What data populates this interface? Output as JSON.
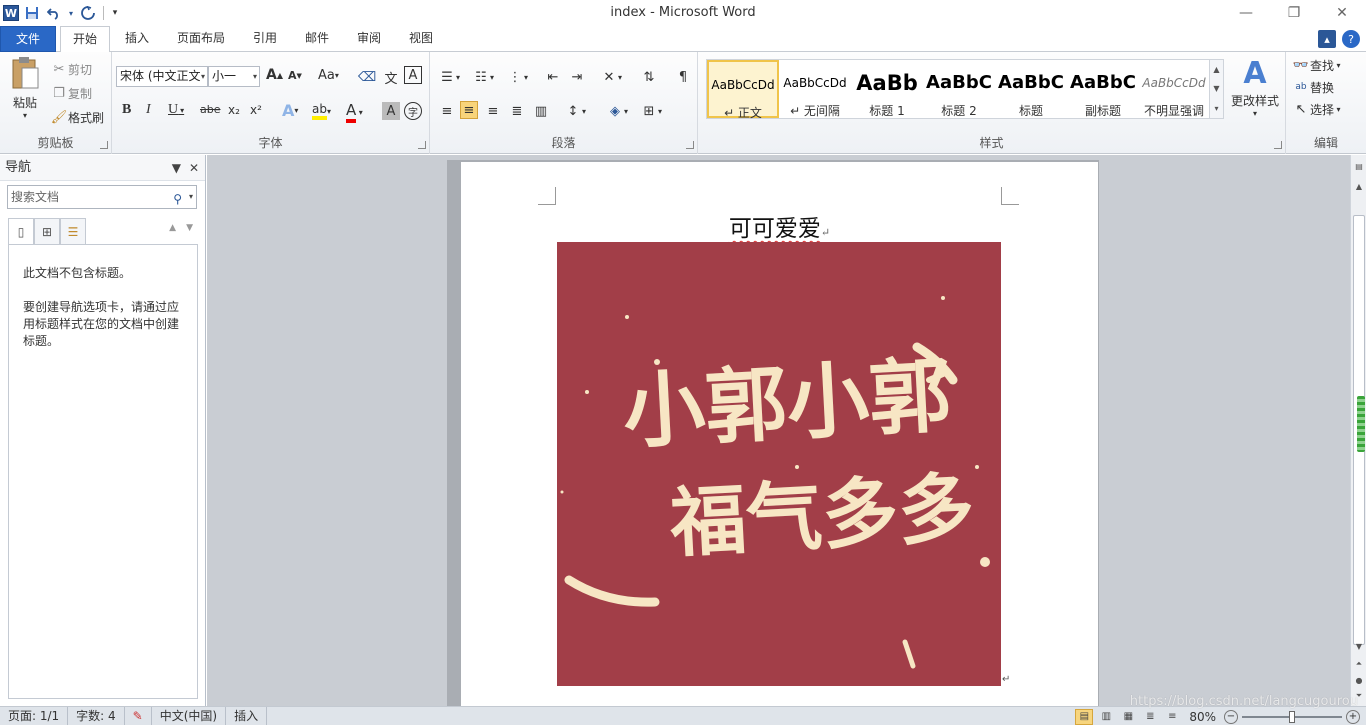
{
  "window": {
    "title": "index  -  Microsoft Word",
    "app_icon_letter": "W",
    "minimize": "—",
    "restore": "❐",
    "close": "✕"
  },
  "quick_access": {
    "save_icon": "save-icon",
    "undo_icon": "undo-icon",
    "redo_icon": "redo-icon",
    "customize_icon": "chevron-down-icon"
  },
  "tabs": [
    {
      "label": "文件"
    },
    {
      "label": "开始"
    },
    {
      "label": "插入"
    },
    {
      "label": "页面布局"
    },
    {
      "label": "引用"
    },
    {
      "label": "邮件"
    },
    {
      "label": "审阅"
    },
    {
      "label": "视图"
    }
  ],
  "ribbon": {
    "clipboard": {
      "label": "剪贴板",
      "paste": "粘贴",
      "cut": "剪切",
      "copy": "复制",
      "format_painter": "格式刷"
    },
    "font": {
      "label": "字体",
      "font_name": "宋体 (中文正文",
      "font_size": "小一",
      "grow": "A",
      "shrink": "A",
      "change_case": "Aa",
      "bold": "B",
      "italic": "I",
      "underline": "U",
      "strike": "abe",
      "subscript": "x₂",
      "superscript": "x²",
      "text_effect": "A",
      "highlight": "ab",
      "font_color": "A",
      "char_shade": "A",
      "enclose": "字"
    },
    "paragraph": {
      "label": "段落"
    },
    "styles": {
      "label": "样式",
      "items": [
        {
          "sample": "AaBbCcDd",
          "name": "↵ 正文"
        },
        {
          "sample": "AaBbCcDd",
          "name": "↵ 无间隔"
        },
        {
          "sample": "AaBb",
          "name": "标题 1"
        },
        {
          "sample": "AaBbC",
          "name": "标题 2"
        },
        {
          "sample": "AaBbC",
          "name": "标题"
        },
        {
          "sample": "AaBbC",
          "name": "副标题"
        },
        {
          "sample": "AaBbCcDd",
          "name": "不明显强调"
        }
      ],
      "change_styles": "更改样式"
    },
    "editing": {
      "label": "编辑",
      "find": "查找",
      "replace": "替换",
      "select": "选择"
    }
  },
  "nav_pane": {
    "title": "导航",
    "search_placeholder": "搜索文档",
    "empty_line1": "此文档不包含标题。",
    "empty_line2": "要创建导航选项卡，请通过应用标题样式在您的文档中创建标题。"
  },
  "document": {
    "title": "可可爱爱",
    "paragraph_mark": "↵",
    "picture": {
      "background_color": "#a23e48",
      "ink_color": "#f7e6c4",
      "text_line1": "小郭小郭",
      "text_line2": "福气多多"
    }
  },
  "status_bar": {
    "page": "页面: 1/1",
    "words": "字数: 4",
    "language": "中文(中国)",
    "mode": "插入",
    "zoom": "80%",
    "zoom_minus": "−",
    "zoom_plus": "+"
  },
  "watermark": "https://blog.csdn.net/langcugourou"
}
